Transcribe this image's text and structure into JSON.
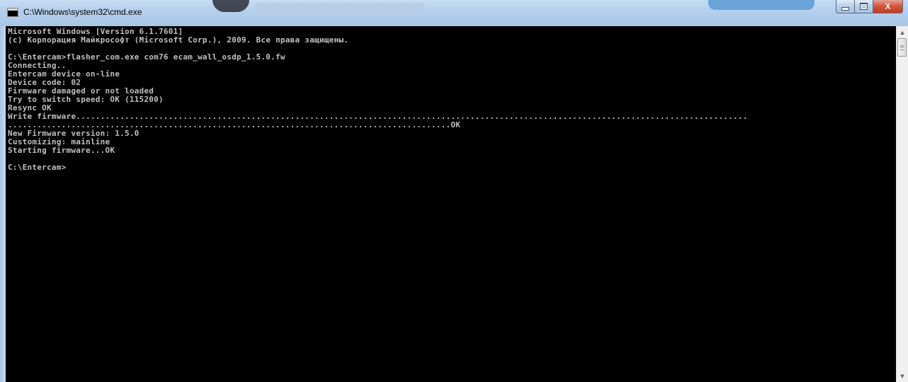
{
  "window": {
    "title": "C:\\Windows\\system32\\cmd.exe",
    "icon": "cmd-console-icon",
    "controls": {
      "minimize": "minimize-icon",
      "maximize": "maximize-icon",
      "close_label": "X"
    }
  },
  "console": {
    "text_color": "#c0c0c0",
    "background": "#000000",
    "lines": [
      "Microsoft Windows [Version 6.1.7601]",
      "(c) Корпорация Майкрософт (Microsoft Corp.), 2009. Все права защищены.",
      "",
      "C:\\Entercam>flasher_com.exe com76 ecam_wall_osdp_1.5.0.fw",
      "Connecting..",
      "Entercam device on-line",
      "Device code: 02",
      "Firmware damaged or not loaded",
      "Try to switch speed: OK (115200)",
      "Resync OK",
      "Write firmware..........................................................................................................................................",
      "...........................................................................................OK",
      "New Firmware version: 1.5.0",
      "Customizing: mainline",
      "Starting firmware...OK",
      "",
      "C:\\Entercam>"
    ]
  },
  "scrollbar": {
    "up_icon": "scroll-up-arrow-icon",
    "down_icon": "scroll-down-arrow-icon"
  }
}
